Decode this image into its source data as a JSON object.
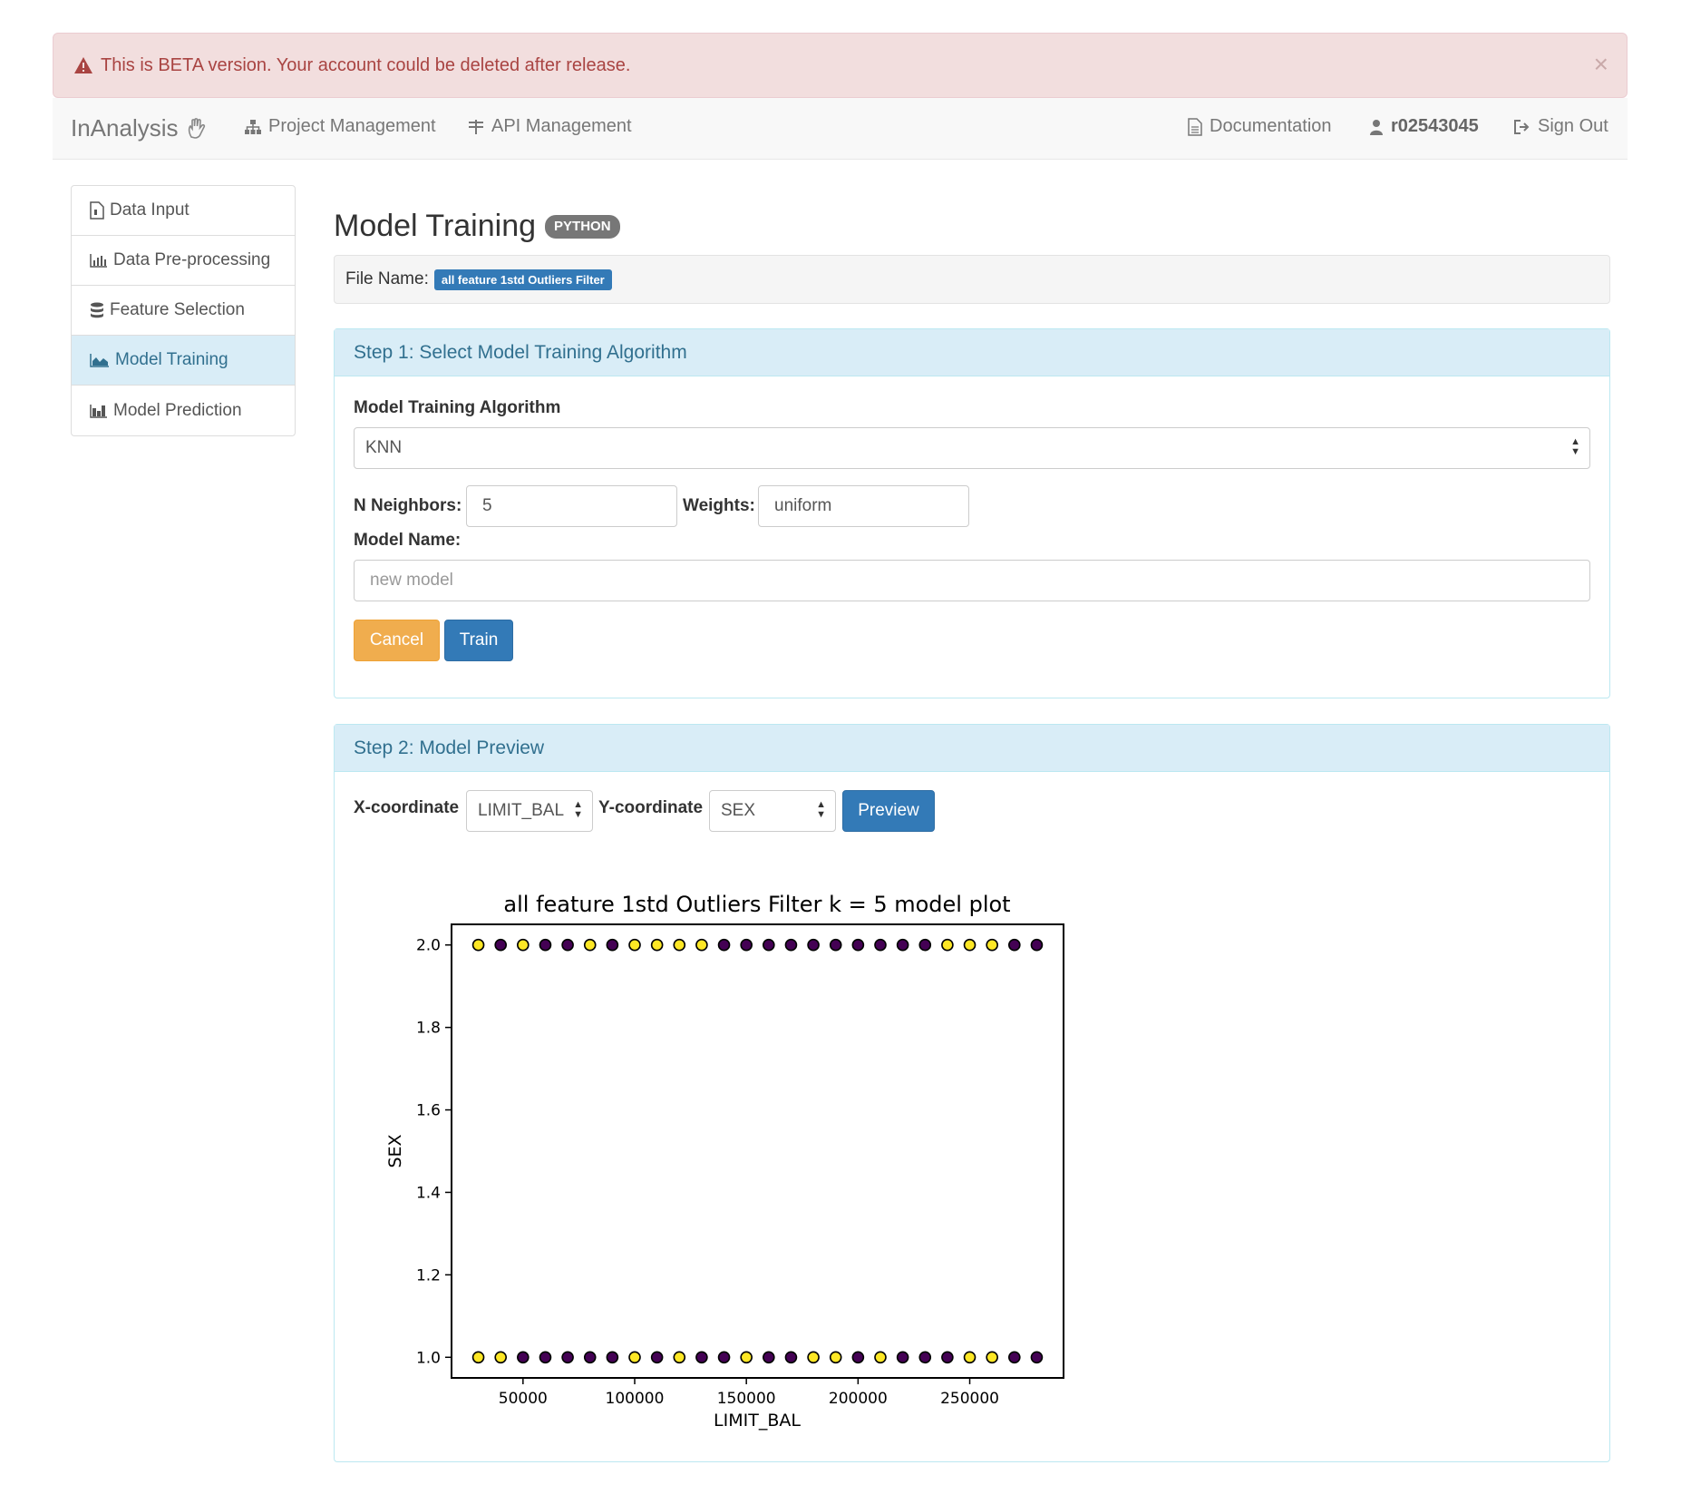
{
  "alert": {
    "message": "This is BETA version. Your account could be deleted after release.",
    "close": "×"
  },
  "navbar": {
    "brand": "InAnalysis",
    "project_management": "Project Management",
    "api_management": "API Management",
    "documentation": "Documentation",
    "username": "r02543045",
    "sign_out": "Sign Out"
  },
  "sidebar": {
    "items": [
      {
        "label": "Data Input",
        "icon": "file-icon"
      },
      {
        "label": "Data Pre-processing",
        "icon": "bar-chart-icon"
      },
      {
        "label": "Feature Selection",
        "icon": "database-icon"
      },
      {
        "label": "Model Training",
        "icon": "area-chart-icon",
        "active": true
      },
      {
        "label": "Model Prediction",
        "icon": "column-chart-icon"
      }
    ]
  },
  "main": {
    "title": "Model Training",
    "language_badge": "PYTHON",
    "file_name_label": "File Name:",
    "file_name": "all feature 1std Outliers Filter"
  },
  "step1": {
    "heading": "Step 1: Select Model Training Algorithm",
    "algorithm_label": "Model Training Algorithm",
    "algorithm_value": "KNN",
    "neighbors_label": "N Neighbors:",
    "neighbors_value": "5",
    "weights_label": "Weights:",
    "weights_value": "uniform",
    "model_name_label": "Model Name:",
    "model_name_placeholder": "new model",
    "cancel": "Cancel",
    "train": "Train"
  },
  "step2": {
    "heading": "Step 2: Model Preview",
    "x_label": "X-coordinate",
    "x_value": "LIMIT_BAL",
    "y_label": "Y-coordinate",
    "y_value": "SEX",
    "preview": "Preview"
  },
  "colors": {
    "yellow": "#fde725",
    "purple": "#440154",
    "primary": "#337ab7",
    "warning": "#f0ad4e"
  },
  "chart_data": {
    "type": "scatter",
    "title": "all feature 1std Outliers Filter k = 5  model plot",
    "xlabel": "LIMIT_BAL",
    "ylabel": "SEX",
    "xlim": [
      18000,
      292000
    ],
    "ylim": [
      0.95,
      2.05
    ],
    "xticks": [
      50000,
      100000,
      150000,
      200000,
      250000
    ],
    "yticks": [
      1.0,
      1.2,
      1.4,
      1.6,
      1.8,
      2.0
    ],
    "xtick_labels": [
      "50000",
      "100000",
      "150000",
      "200000",
      "250000"
    ],
    "ytick_labels": [
      "1.0",
      "1.2",
      "1.4",
      "1.6",
      "1.8",
      "2.0"
    ],
    "x_values": [
      30000,
      40000,
      50000,
      60000,
      70000,
      80000,
      90000,
      100000,
      110000,
      120000,
      130000,
      140000,
      150000,
      160000,
      170000,
      180000,
      190000,
      200000,
      210000,
      220000,
      230000,
      240000,
      250000,
      260000,
      270000,
      280000
    ],
    "series": [
      {
        "y": 2.0,
        "classes": [
          1,
          0,
          1,
          0,
          0,
          1,
          0,
          1,
          1,
          1,
          1,
          0,
          0,
          0,
          0,
          0,
          0,
          0,
          0,
          0,
          0,
          1,
          1,
          1,
          0,
          0
        ]
      },
      {
        "y": 1.0,
        "classes": [
          1,
          1,
          0,
          0,
          0,
          0,
          0,
          1,
          0,
          1,
          0,
          0,
          1,
          0,
          0,
          1,
          1,
          0,
          1,
          0,
          0,
          0,
          1,
          1,
          0,
          0
        ]
      }
    ]
  }
}
